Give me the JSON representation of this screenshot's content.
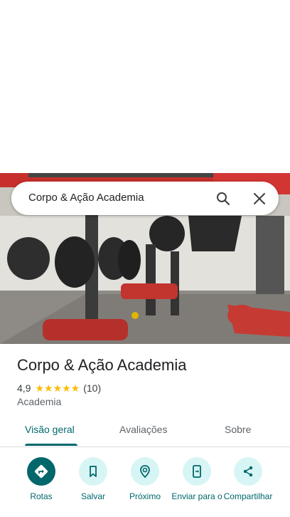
{
  "search": {
    "query": "Corpo & Ação Academia"
  },
  "place": {
    "name": "Corpo & Ação Academia",
    "rating": "4,9",
    "stars": "★★★★★",
    "review_count": "(10)",
    "category": "Academia"
  },
  "tabs": [
    {
      "label": "Visão geral",
      "active": true
    },
    {
      "label": "Avaliações",
      "active": false
    },
    {
      "label": "Sobre",
      "active": false
    }
  ],
  "actions": [
    {
      "label": "Rotas",
      "icon": "directions-icon"
    },
    {
      "label": "Salvar",
      "icon": "bookmark-icon"
    },
    {
      "label": "Próximo",
      "icon": "nearby-icon"
    },
    {
      "label": "Enviar para o",
      "icon": "send-to-phone-icon"
    },
    {
      "label": "Compartilhar",
      "icon": "share-icon"
    }
  ],
  "colors": {
    "accent": "#00676b",
    "action_bg": "#d7f5f5",
    "star": "#fbbc04"
  }
}
